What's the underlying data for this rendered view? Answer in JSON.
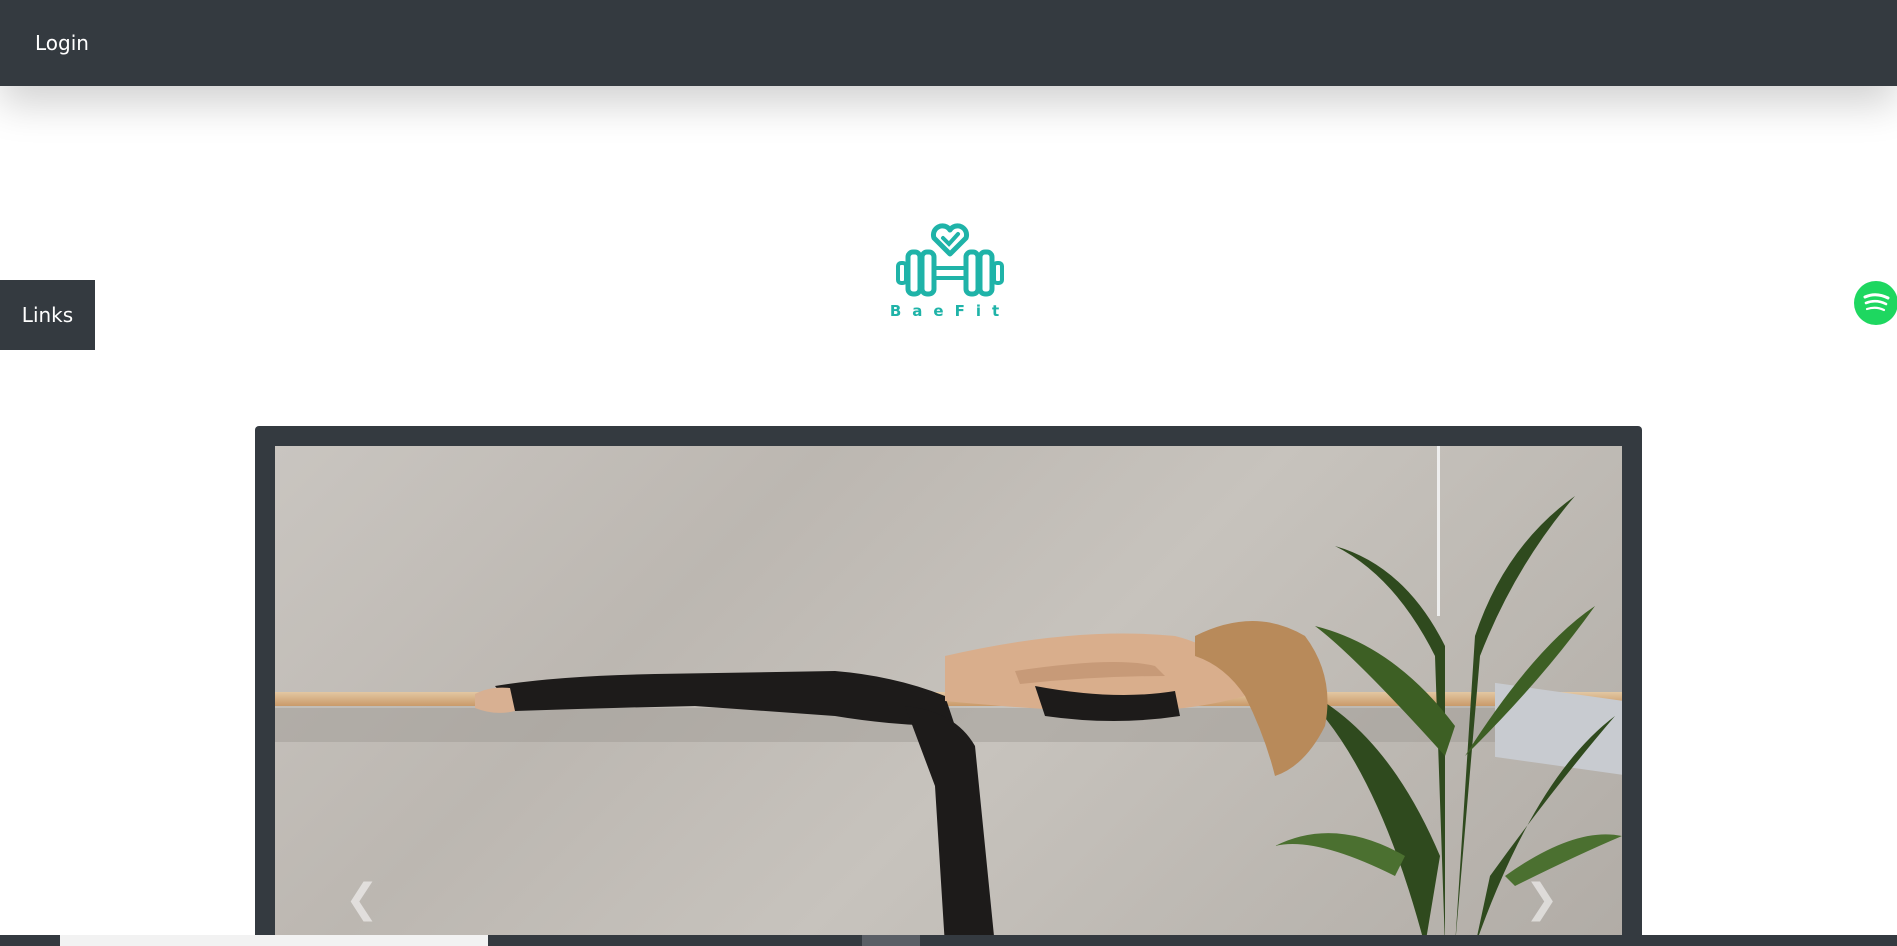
{
  "nav": {
    "login_label": "Login"
  },
  "sidebar": {
    "links_label": "Links"
  },
  "brand": {
    "logo_text": "BaeFit",
    "color": "#1fb3a8"
  },
  "carousel": {
    "prev_icon": "chevron-left-icon",
    "next_icon": "chevron-right-icon"
  },
  "colors": {
    "nav_bg": "#343a40",
    "spotify": "#1ed760"
  }
}
